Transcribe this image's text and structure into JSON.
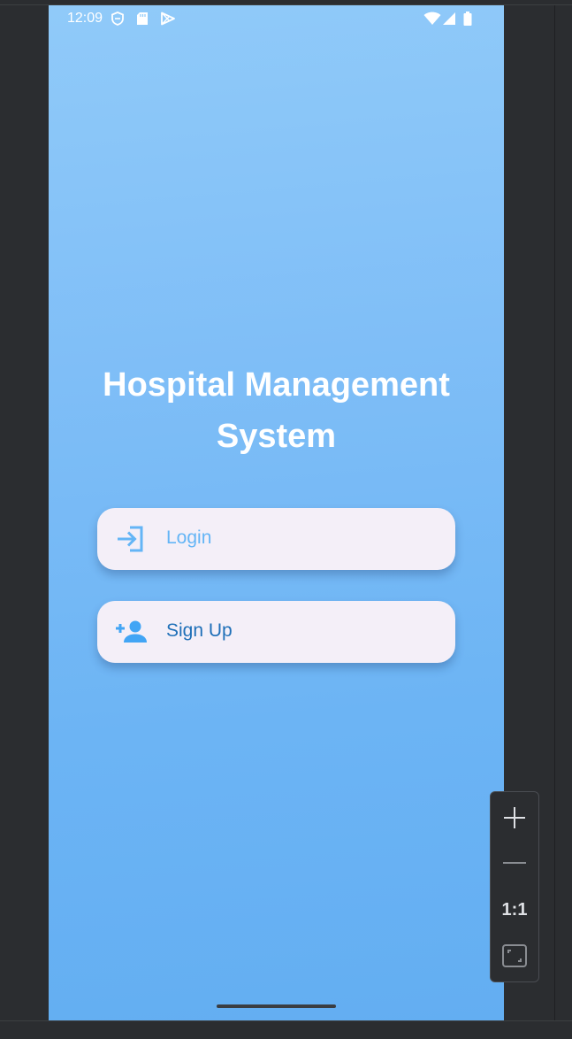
{
  "status_bar": {
    "time": "12:09",
    "left_icons": [
      "shield-icon",
      "sd-card-icon",
      "play-store-icon"
    ],
    "right_icons": [
      "wifi-icon",
      "cellular-signal-icon",
      "battery-icon"
    ]
  },
  "app": {
    "title_line1": "Hospital Management",
    "title_line2": "System",
    "buttons": {
      "login": {
        "label": "Login",
        "icon": "login-icon"
      },
      "signup": {
        "label": "Sign Up",
        "icon": "person-add-icon"
      }
    }
  },
  "zoom_controls": {
    "reset_label": "1:1",
    "icons": [
      "zoom-in-icon",
      "zoom-out-icon",
      "fit-screen-icon"
    ]
  },
  "colors": {
    "gradient_top": "#90caf9",
    "gradient_bottom": "#63aef2",
    "button_bg": "#f4eff8",
    "login_accent": "#64b5f6",
    "signup_accent": "#1e6fb8",
    "ide_background": "#2b2d30"
  }
}
